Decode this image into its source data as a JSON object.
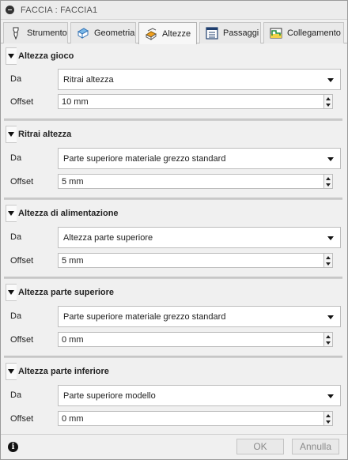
{
  "window": {
    "title": "FACCIA : FACCIA1"
  },
  "tabs": [
    {
      "label": "Strumento",
      "icon": "tool-icon",
      "active": false
    },
    {
      "label": "Geometria",
      "icon": "geometry-icon",
      "active": false
    },
    {
      "label": "Altezze",
      "icon": "heights-icon",
      "active": true
    },
    {
      "label": "Passaggi",
      "icon": "passes-icon",
      "active": false
    },
    {
      "label": "Collegamento",
      "icon": "linking-icon",
      "active": false
    }
  ],
  "labels": {
    "from": "Da",
    "offset": "Offset"
  },
  "sections": [
    {
      "title": "Altezza gioco",
      "from": "Ritrai altezza",
      "offset": "10 mm"
    },
    {
      "title": "Ritrai altezza",
      "from": "Parte superiore materiale grezzo standard",
      "offset": "5 mm"
    },
    {
      "title": "Altezza di alimentazione",
      "from": "Altezza parte superiore",
      "offset": "5 mm"
    },
    {
      "title": "Altezza parte superiore",
      "from": "Parte superiore materiale grezzo standard",
      "offset": "0 mm"
    },
    {
      "title": "Altezza parte inferiore",
      "from": "Parte superiore modello",
      "offset": "0 mm"
    }
  ],
  "footer": {
    "ok_label": "OK",
    "cancel_label": "Annulla",
    "info_icon": "info-icon"
  },
  "colors": {
    "panel": "#f0f0f0",
    "accent_orange": "#f0a020",
    "accent_blue": "#2f6fb3"
  }
}
